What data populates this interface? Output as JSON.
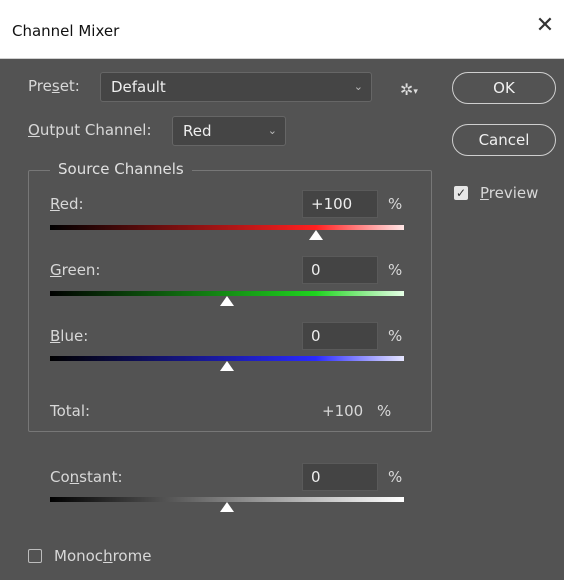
{
  "window": {
    "title": "Channel Mixer"
  },
  "preset": {
    "label_start": "Pre",
    "label_u": "s",
    "label_end": "et:",
    "value": "Default"
  },
  "output_channel": {
    "label_u": "O",
    "label_rest": "utput Channel:",
    "value": "Red"
  },
  "buttons": {
    "ok": "OK",
    "cancel": "Cancel"
  },
  "preview": {
    "label_u": "P",
    "label_rest": "review",
    "checked": true
  },
  "source_channels": {
    "title": "Source Channels",
    "red": {
      "label_u": "R",
      "label_rest": "ed:",
      "value": "+100",
      "unit": "%",
      "level": 100
    },
    "green": {
      "label_u": "G",
      "label_rest": "reen:",
      "value": "0",
      "unit": "%",
      "level": 0
    },
    "blue": {
      "label_u": "B",
      "label_rest": "lue:",
      "value": "0",
      "unit": "%",
      "level": 0
    },
    "total": {
      "label": "Total:",
      "value": "+100",
      "unit": "%"
    }
  },
  "constant": {
    "label_start": "Co",
    "label_u": "n",
    "label_end": "stant:",
    "value": "0",
    "unit": "%",
    "level": 0
  },
  "monochrome": {
    "label_start": "Monoc",
    "label_u": "h",
    "label_end": "rome",
    "checked": false
  },
  "colors": {
    "dialog_bg": "#535353",
    "titlebar_bg": "#ffffff",
    "red": "#ff2b2b",
    "green": "#2bd62b",
    "blue": "#3a3aff"
  }
}
